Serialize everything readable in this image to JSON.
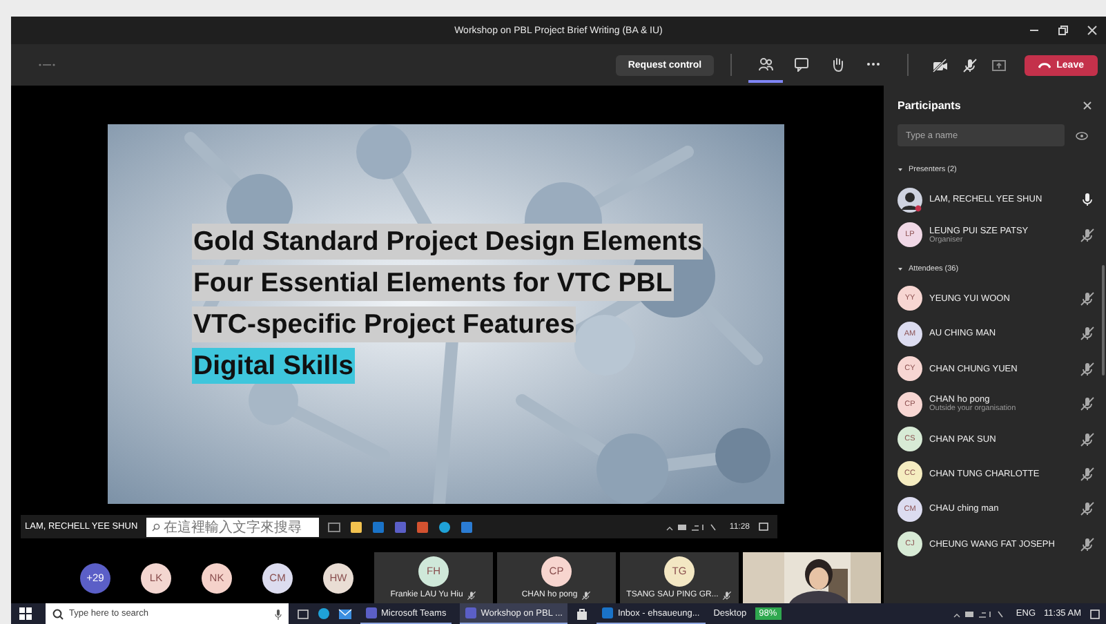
{
  "window": {
    "title": "Workshop on PBL Project Brief Writing (BA & IU)"
  },
  "toolbar": {
    "request_button": "Request control",
    "icons": [
      {
        "kind": "people",
        "selected": true
      },
      {
        "kind": "chat",
        "selected": false
      },
      {
        "kind": "hand",
        "selected": false
      },
      {
        "kind": "more",
        "selected": false
      }
    ],
    "leave_button": "Leave"
  },
  "shared_screen": {
    "slide_lines": [
      {
        "text": "Gold Standard Project Design Elements",
        "color": "#cdcdcd"
      },
      {
        "text": "Four Essential Elements for VTC PBL",
        "color": "#cdcdcd"
      },
      {
        "text": "VTC-specific Project Features",
        "color": "#cdcdcd"
      },
      {
        "text": "Digital Skills",
        "color": "#3ec6dc"
      }
    ],
    "presenter_label": "LAM, RECHELL YEE SHUN",
    "remote_taskbar": {
      "search_placeholder": "在這裡輸入文字來搜尋",
      "time": "11:28"
    }
  },
  "stage_strip": {
    "overflow_count": "+29",
    "avatars": [
      {
        "initials": "LK",
        "color": "#f3d6d0"
      },
      {
        "initials": "NK",
        "color": "#f5d2ca"
      },
      {
        "initials": "CM",
        "color": "#dcdcef"
      },
      {
        "initials": "HW",
        "color": "#e9ddd4"
      }
    ],
    "tiles": [
      {
        "initials": "FH",
        "name": "Frankie LAU Yu Hiu",
        "color": "#cfe8d9"
      },
      {
        "initials": "CP",
        "name": "CHAN ho pong",
        "color": "#f7d5cf"
      },
      {
        "initials": "TG",
        "name": "TSANG SAU PING GR...",
        "color": "#f3e7c3"
      }
    ]
  },
  "participants": {
    "title": "Participants",
    "search": {
      "placeholder": "Type a name"
    },
    "groups": [
      {
        "label": "Presenters (2)",
        "expanded": true,
        "people": [
          {
            "name": "LAM, RECHELL YEE SHUN",
            "muted": false
          },
          {
            "initials": "LP",
            "name": "LEUNG PUI SZE PATSY",
            "subtitle": "Organiser",
            "color": "#f0d8e6",
            "kind": "initials",
            "muted": true
          }
        ]
      },
      {
        "label": "Attendees (36)",
        "expanded": true,
        "people": [
          {
            "initials": "YY",
            "name": "YEUNG YUI WOON",
            "color": "#f7d6d2",
            "kind": "initials",
            "muted": true
          },
          {
            "initials": "AM",
            "name": "AU CHING MAN",
            "color": "#dcdcf0",
            "kind": "initials",
            "muted": true
          },
          {
            "initials": "CY",
            "name": "CHAN CHUNG YUEN",
            "color": "#f7d6d2",
            "kind": "initials",
            "muted": true
          },
          {
            "initials": "CP",
            "name": "CHAN ho pong",
            "subtitle": "Outside your organisation",
            "color": "#f7d6d2",
            "kind": "initials",
            "muted": true
          },
          {
            "initials": "CS",
            "name": "CHAN PAK SUN",
            "color": "#d7ead5",
            "kind": "initials",
            "muted": true
          },
          {
            "initials": "CC",
            "name": "CHAN TUNG CHARLOTTE",
            "color": "#f5ecc0",
            "kind": "initials",
            "muted": true
          },
          {
            "initials": "CM",
            "name": "CHAU ching man",
            "color": "#dcdcf0",
            "kind": "initials",
            "muted": true
          },
          {
            "initials": "CJ",
            "name": "CHEUNG WANG FAT JOSEPH",
            "color": "#d7ead5",
            "kind": "initials",
            "muted": true
          }
        ]
      }
    ]
  },
  "taskbar": {
    "search_placeholder": "Type here to search",
    "apps": [
      {
        "label": "Microsoft Teams",
        "selected": false
      },
      {
        "label": "Workshop on PBL ...",
        "selected": true
      },
      {
        "label": "Inbox - ehsaueung...",
        "selected": false
      }
    ],
    "desktop_label": "Desktop",
    "battery": "98%",
    "language": "ENG",
    "time": "11:35 AM"
  }
}
